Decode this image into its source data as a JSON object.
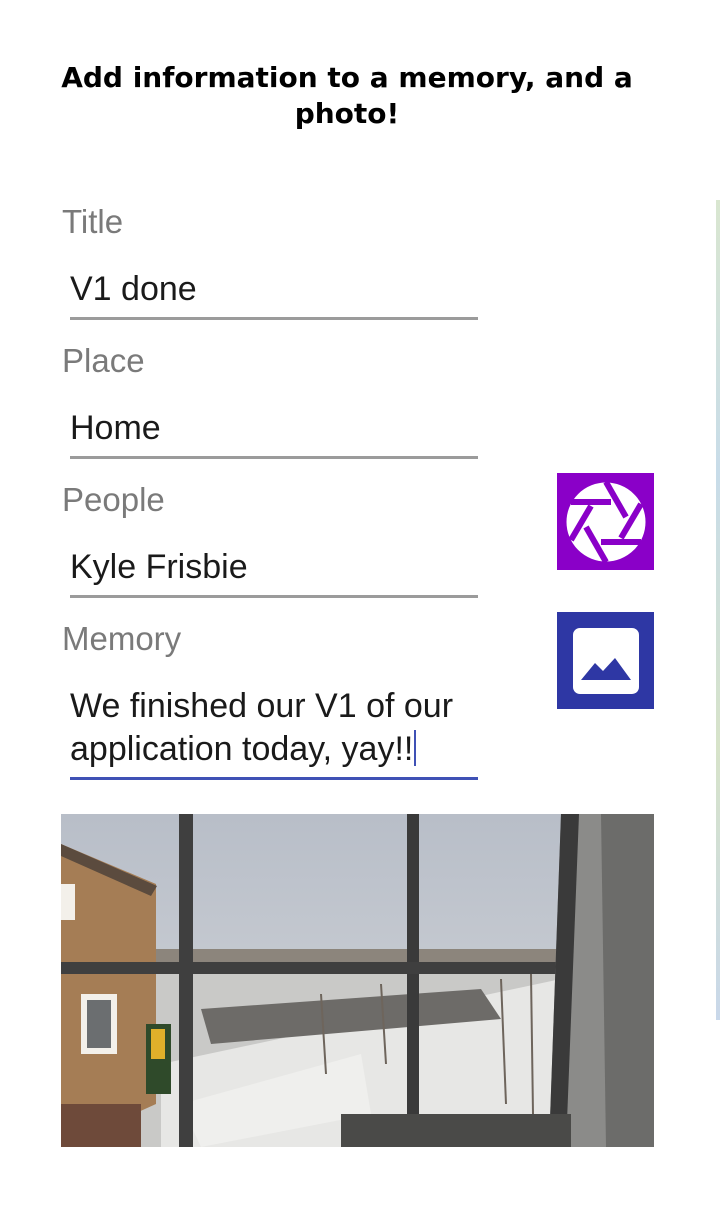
{
  "header": {
    "title": "Add information to a memory, and a photo!"
  },
  "form": {
    "title_label": "Title",
    "title_value": "V1 done",
    "place_label": "Place",
    "place_value": "Home",
    "people_label": "People",
    "people_value": "Kyle Frisbie",
    "memory_label": "Memory",
    "memory_value": "We finished our V1 of our application today, yay!!"
  },
  "buttons": {
    "camera_icon": "camera-shutter-icon",
    "gallery_icon": "image-gallery-icon"
  },
  "colors": {
    "camera_button": "#8a00c8",
    "gallery_button": "#2e37a4",
    "active_underline": "#3f51b5"
  }
}
